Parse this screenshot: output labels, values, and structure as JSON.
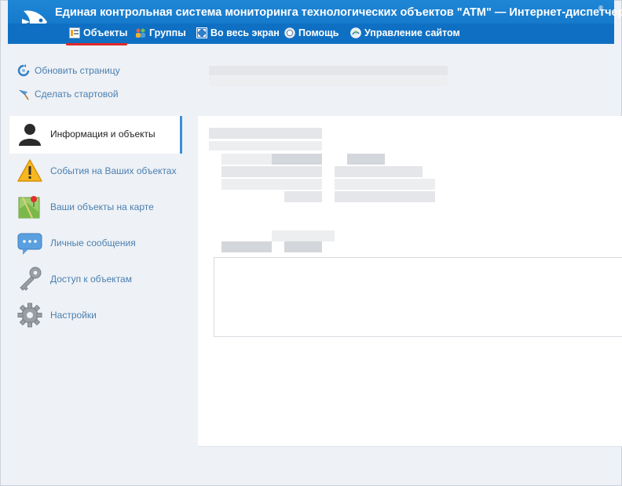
{
  "header": {
    "title": "Единая контрольная система мониторинга технологических объектов \"ATM\" — Интернет-диспетчерская",
    "reg_mark": "®"
  },
  "menu": [
    {
      "label": "Объекты",
      "icon": "objects-icon",
      "active": true
    },
    {
      "label": "Группы",
      "icon": "groups-icon"
    },
    {
      "label": "Во весь экран",
      "icon": "fullscreen-icon"
    },
    {
      "label": "Помощь",
      "icon": "help-icon"
    },
    {
      "label": "Управление сайтом",
      "icon": "site-management-icon"
    }
  ],
  "side_links": [
    {
      "label": "Обновить страницу",
      "icon": "refresh-icon"
    },
    {
      "label": "Сделать стартовой",
      "icon": "pin-icon"
    }
  ],
  "nav": [
    {
      "label": "Информация и объекты",
      "icon": "user-icon",
      "active": true
    },
    {
      "label": "События на Ваших объектах",
      "icon": "warning-icon"
    },
    {
      "label": "Ваши объекты на карте",
      "icon": "map-icon"
    },
    {
      "label": "Личные сообщения",
      "icon": "messages-icon"
    },
    {
      "label": "Доступ к объектам",
      "icon": "key-icon"
    },
    {
      "label": "Настройки",
      "icon": "settings-gear-icon"
    }
  ],
  "colors": {
    "header_blue": "#1f86d6",
    "menu_blue": "#0f70c3",
    "active_underline": "#e02828",
    "link_blue": "#4a7fb1"
  }
}
